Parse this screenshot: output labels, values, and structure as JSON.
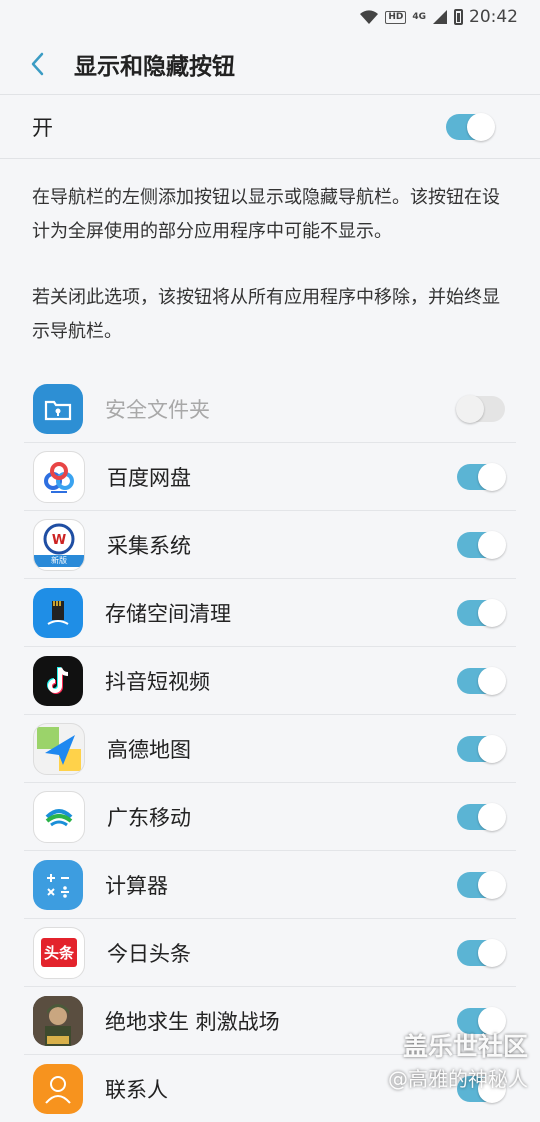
{
  "status_bar": {
    "time": "20:42",
    "hd_label": "HD",
    "network_label": "4G"
  },
  "header": {
    "title": "显示和隐藏按钮"
  },
  "master": {
    "label": "开",
    "on": true
  },
  "description": {
    "para1": "在导航栏的左侧添加按钮以显示或隐藏导航栏。该按钮在设计为全屏使用的部分应用程序中可能不显示。",
    "para2": "若关闭此选项，该按钮将从所有应用程序中移除，并始终显示导航栏。"
  },
  "apps": [
    {
      "label": "安全文件夹",
      "icon": "secure-folder-icon",
      "on": false,
      "disabled": true
    },
    {
      "label": "百度网盘",
      "icon": "baidu-netdisk-icon",
      "on": true
    },
    {
      "label": "采集系统",
      "icon": "collection-system-icon",
      "on": true,
      "badge": "新版"
    },
    {
      "label": "存储空间清理",
      "icon": "storage-cleaner-icon",
      "on": true
    },
    {
      "label": "抖音短视频",
      "icon": "douyin-icon",
      "on": true
    },
    {
      "label": "高德地图",
      "icon": "amap-icon",
      "on": true
    },
    {
      "label": "广东移动",
      "icon": "china-mobile-icon",
      "on": true
    },
    {
      "label": "计算器",
      "icon": "calculator-icon",
      "on": true
    },
    {
      "label": "今日头条",
      "icon": "toutiao-icon",
      "on": true,
      "badge": "头条"
    },
    {
      "label": "绝地求生 刺激战场",
      "icon": "pubg-icon",
      "on": true
    },
    {
      "label": "联系人",
      "icon": "contacts-icon",
      "on": true
    }
  ],
  "watermark": {
    "title": "盖乐世社区",
    "author": "@高雅的神秘人"
  },
  "colors": {
    "accent": "#5bb4d4",
    "toggle_off": "#e4e4e4"
  }
}
